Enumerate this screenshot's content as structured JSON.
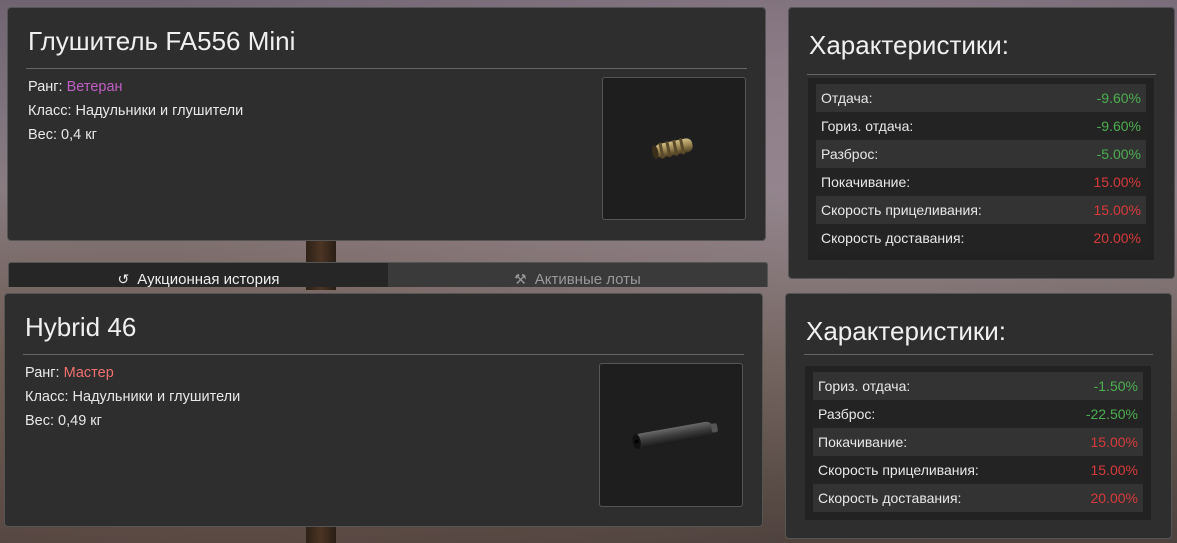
{
  "item1": {
    "title": "Глушитель FA556 Mini",
    "rank_label": "Ранг: ",
    "rank_value": "Ветеран",
    "class_line": "Класс: Надульники и глушители",
    "weight_line": "Вес: 0,4 кг"
  },
  "stats1": {
    "title": "Характеристики:",
    "rows": [
      {
        "label": "Отдача:",
        "value": "-9.60%",
        "status": "positive"
      },
      {
        "label": "Гориз. отдача:",
        "value": "-9.60%",
        "status": "positive"
      },
      {
        "label": "Разброс:",
        "value": "-5.00%",
        "status": "positive"
      },
      {
        "label": "Покачивание:",
        "value": "15.00%",
        "status": "negative"
      },
      {
        "label": "Скорость прицеливания:",
        "value": "15.00%",
        "status": "negative"
      },
      {
        "label": "Скорость доставания:",
        "value": "20.00%",
        "status": "negative"
      }
    ]
  },
  "tabs": [
    {
      "label": "Аукционная история",
      "icon": "history-icon",
      "active": true
    },
    {
      "label": "Активные лоты",
      "icon": "gavel-icon",
      "active": false
    }
  ],
  "item2": {
    "title": "Hybrid 46",
    "rank_label": "Ранг: ",
    "rank_value": "Мастер",
    "class_line": "Класс: Надульники и глушители",
    "weight_line": "Вес: 0,49 кг"
  },
  "stats2": {
    "title": "Характеристики:",
    "rows": [
      {
        "label": "Гориз. отдача:",
        "value": "-1.50%",
        "status": "positive"
      },
      {
        "label": "Разброс:",
        "value": "-22.50%",
        "status": "positive"
      },
      {
        "label": "Покачивание:",
        "value": "15.00%",
        "status": "negative"
      },
      {
        "label": "Скорость прицеливания:",
        "value": "15.00%",
        "status": "negative"
      },
      {
        "label": "Скорость доставания:",
        "value": "20.00%",
        "status": "negative"
      }
    ]
  },
  "colors": {
    "positive": "#4caf50",
    "negative": "#d83a3a",
    "rank_veteran": "#c05fc4",
    "rank_master": "#f07070"
  }
}
